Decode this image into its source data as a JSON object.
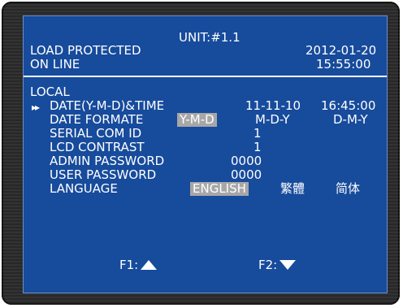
{
  "header": {
    "unit": "UNIT:#1.1",
    "status_line1": "LOAD PROTECTED",
    "status_line2": "ON LINE",
    "date": "2012-01-20",
    "time": "15:55:00"
  },
  "local": {
    "section_title": "LOCAL",
    "selected_marker": "▸▸",
    "rows": [
      {
        "label": "DATE(Y-M-D)&TIME",
        "value1": "11-11-10",
        "value2": "16:45:00"
      },
      {
        "label": "DATE FORMATE",
        "options": [
          "Y-M-D",
          "M-D-Y",
          "D-M-Y"
        ],
        "selected": "Y-M-D"
      },
      {
        "label": "SERIAL COM ID",
        "value": "1"
      },
      {
        "label": "LCD CONTRAST",
        "value": "1"
      },
      {
        "label": "ADMIN PASSWORD",
        "value": "0000"
      },
      {
        "label": "USER PASSWORD",
        "value": "0000"
      },
      {
        "label": "LANGUAGE",
        "options": [
          "ENGLISH",
          "繁體",
          "简体"
        ],
        "selected": "ENGLISH"
      }
    ]
  },
  "footer": {
    "f1_label": "F1:",
    "f1_icon": "up-triangle-icon",
    "f2_label": "F2:",
    "f2_icon": "down-triangle-icon"
  },
  "colors": {
    "screen_bg": "#174b9c",
    "highlight": "#a7a7a7",
    "text": "#ffffff",
    "bezel": "#2b2b2b"
  }
}
